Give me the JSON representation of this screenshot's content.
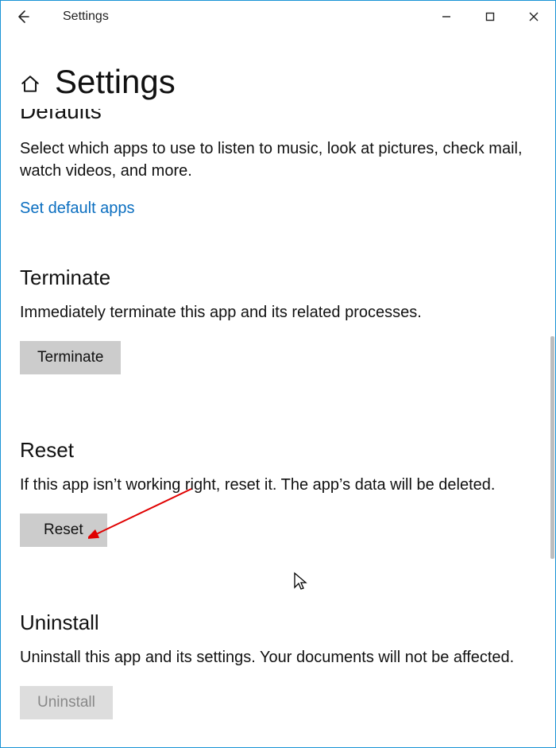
{
  "window": {
    "title": "Settings"
  },
  "header": {
    "title": "Settings"
  },
  "defaults": {
    "cutoff_heading": "Defaults",
    "description": "Select which apps to use to listen to music, look at pictures, check mail, watch videos, and more.",
    "link_label": "Set default apps"
  },
  "terminate": {
    "heading": "Terminate",
    "description": "Immediately terminate this app and its related processes.",
    "button_label": "Terminate"
  },
  "reset": {
    "heading": "Reset",
    "description": "If this app isn’t working right, reset it. The app’s data will be deleted.",
    "button_label": "Reset"
  },
  "uninstall": {
    "heading": "Uninstall",
    "description": "Uninstall this app and its settings. Your documents will not be affected.",
    "button_label": "Uninstall"
  }
}
